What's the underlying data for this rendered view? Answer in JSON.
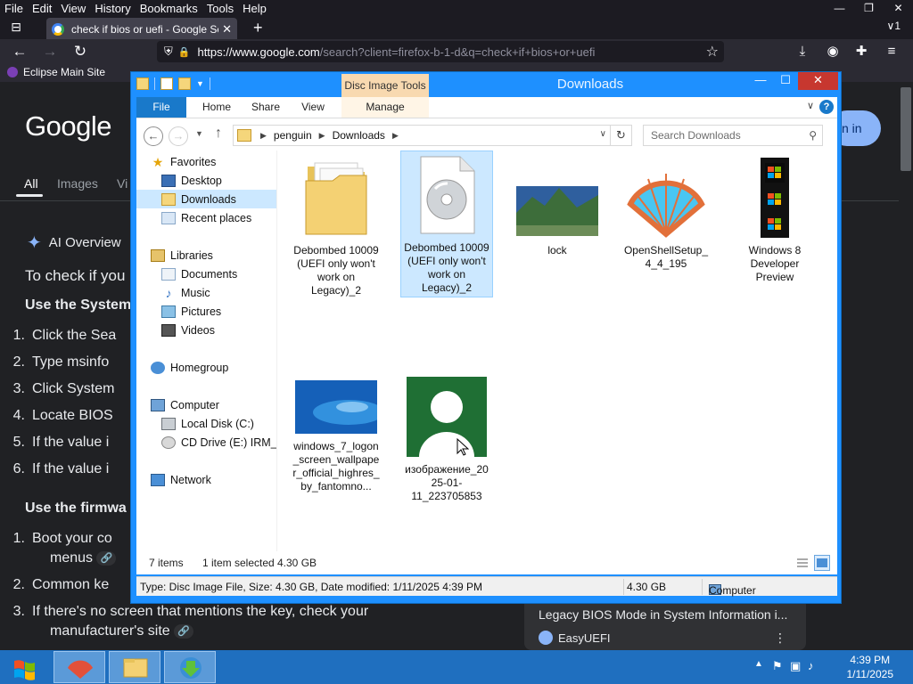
{
  "firefox": {
    "menu": [
      "File",
      "Edit",
      "View",
      "History",
      "Bookmarks",
      "Tools",
      "Help"
    ],
    "window_controls": {
      "minimize": "—",
      "restore": "❐",
      "close": "✕"
    },
    "tab_title": "check if bios or uefi - Google Se",
    "tab_close": "✕",
    "new_tab": "+",
    "tabs_chevron": "∨1",
    "url_host": "https://www.google.com",
    "url_path": "/search?client=firefox-b-1-d&q=check+if+bios+or+uefi",
    "bookmarks": [
      "Eclipse Main Site"
    ]
  },
  "google": {
    "logo": "Google",
    "tabs": [
      "All",
      "Images",
      "Vi"
    ],
    "signin": "n in",
    "ai_overview": "AI Overview",
    "intro": "To check if you",
    "section1": "Use the System",
    "steps1": [
      {
        "n": "1.",
        "text": "Click the Sea"
      },
      {
        "n": "2.",
        "text": "Type msinfo"
      },
      {
        "n": "3.",
        "text": "Click System"
      },
      {
        "n": "4.",
        "text": "Locate BIOS"
      },
      {
        "n": "5.",
        "text": "If the value i"
      },
      {
        "n": "6.",
        "text": "If the value i"
      }
    ],
    "section2": "Use the firmwa",
    "step_b1_line1": "Boot your co",
    "step_b1_line2": "menus",
    "step_b2": "Common ke",
    "step_b3_line1": "If there's no screen that mentions the key, check your",
    "step_b3_line2": "manufacturer's site",
    "steps2_nums": [
      "1.",
      "2.",
      "3."
    ],
    "link_chip": "🔗",
    "side_card_title": "Legacy BIOS Mode in System Information i...",
    "side_card_source": "EasyUEFI",
    "side_card_more": "⋮"
  },
  "explorer": {
    "title": "Downloads",
    "contextual_tab": "Disc Image Tools",
    "ribbon_tabs": [
      "File",
      "Home",
      "Share",
      "View",
      "Manage"
    ],
    "breadcrumb": [
      "penguin",
      "Downloads"
    ],
    "search_placeholder": "Search Downloads",
    "nav": [
      {
        "label": "Favorites",
        "icon": "star-icon"
      },
      {
        "label": "Desktop",
        "icon": "desktop-icon"
      },
      {
        "label": "Downloads",
        "icon": "downloads-folder-icon"
      },
      {
        "label": "Recent places",
        "icon": "recent-places-icon"
      },
      {
        "label": "Libraries",
        "icon": "libraries-icon"
      },
      {
        "label": "Documents",
        "icon": "documents-icon"
      },
      {
        "label": "Music",
        "icon": "music-icon"
      },
      {
        "label": "Pictures",
        "icon": "pictures-icon"
      },
      {
        "label": "Videos",
        "icon": "videos-icon"
      },
      {
        "label": "Homegroup",
        "icon": "homegroup-icon"
      },
      {
        "label": "Computer",
        "icon": "computer-icon"
      },
      {
        "label": "Local Disk (C:)",
        "icon": "local-disk-icon"
      },
      {
        "label": "CD Drive (E:) IRM_CE",
        "icon": "cd-drive-icon"
      },
      {
        "label": "Network",
        "icon": "network-icon"
      }
    ],
    "files": [
      {
        "name": "Debombed 10009 (UEFI only won't work on Legacy)_2",
        "icon": "folder-icon"
      },
      {
        "name": "Debombed 10009 (UEFI only won't work on Legacy)_2",
        "icon": "disc-image-icon"
      },
      {
        "name": "lock",
        "icon": "image-thumbnail-icon"
      },
      {
        "name": "OpenShellSetup_4_4_195",
        "icon": "openshell-icon"
      },
      {
        "name": "Windows 8 Developer Preview",
        "icon": "video-thumbnail-icon"
      },
      {
        "name": "windows_7_logon_screen_wallpaper_official_highres_by_fantomno...",
        "icon": "image-thumbnail-icon"
      },
      {
        "name": "изображение_2025-01-11_223705853",
        "icon": "image-thumbnail-icon"
      }
    ],
    "status_count": "7 items",
    "status_selected": "1 item selected",
    "status_size": "4.30 GB",
    "details_type": "Type: Disc Image File, Size: 4.30 GB, Date modified: 1/11/2025 4:39 PM",
    "details_size": "4.30 GB",
    "details_location": "Computer"
  },
  "taskbar": {
    "time": "4:39 PM",
    "date": "1/11/2025"
  },
  "colors": {
    "explorer_frame": "#1e90ff",
    "selection": "#cce8ff",
    "taskbar": "#1f6fbf",
    "google_bg": "#202124"
  }
}
